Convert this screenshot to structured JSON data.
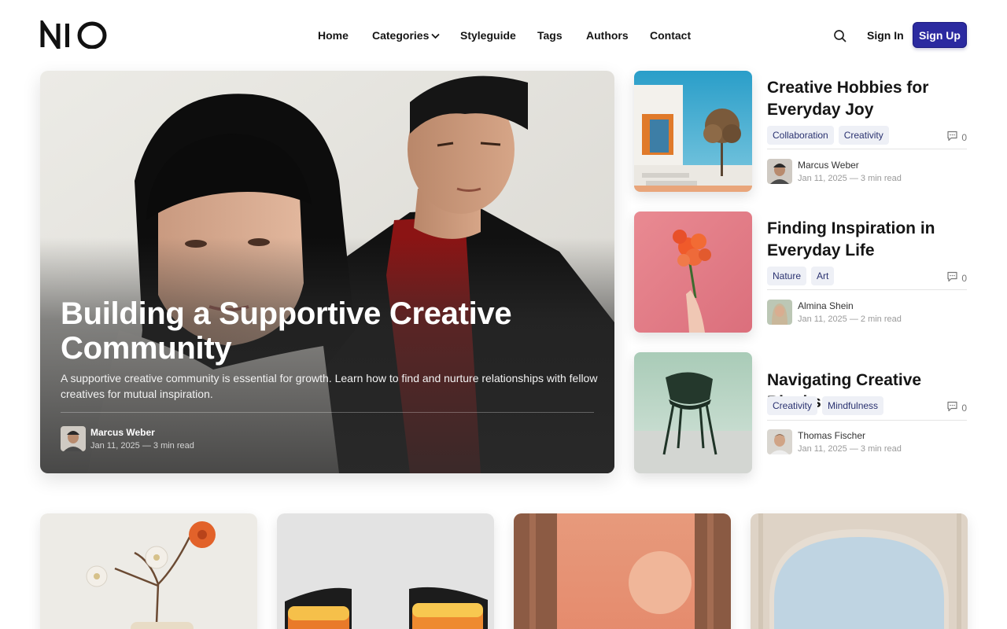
{
  "brand": {
    "logo_text": "NIO"
  },
  "nav": {
    "items": [
      {
        "label": "Home"
      },
      {
        "label": "Categories",
        "has_dropdown": true
      },
      {
        "label": "Styleguide"
      },
      {
        "label": "Tags"
      },
      {
        "label": "Authors"
      },
      {
        "label": "Contact"
      }
    ],
    "search_icon": "search-icon",
    "signin_label": "Sign In",
    "signup_label": "Sign Up"
  },
  "colors": {
    "accent": "#2b2aa0",
    "tag_bg": "#eef0f6",
    "tag_text": "#2a3270"
  },
  "hero": {
    "title": "Building a Supportive Creative Community",
    "excerpt": "A supportive creative community is essential for growth. Learn how to find and nurture relationships with fellow creatives for mutual inspiration.",
    "author": "Marcus Weber",
    "meta": "Jan 11, 2025 — 3 min read"
  },
  "side_posts": [
    {
      "title": "Creative Hobbies for Everyday Joy",
      "tags": [
        "Collaboration",
        "Creativity"
      ],
      "comments": "0",
      "author": "Marcus Weber",
      "meta": "Jan 11, 2025 — 3 min read"
    },
    {
      "title": "Finding Inspiration in Everyday Life",
      "tags": [
        "Nature",
        "Art"
      ],
      "comments": "0",
      "author": "Almina Shein",
      "meta": "Jan 11, 2025 — 2 min read"
    },
    {
      "title": "Navigating Creative Blocks",
      "tags": [
        "Creativity",
        "Mindfulness"
      ],
      "comments": "0",
      "author": "Thomas Fischer",
      "meta": "Jan 11, 2025 — 3 min read"
    }
  ]
}
